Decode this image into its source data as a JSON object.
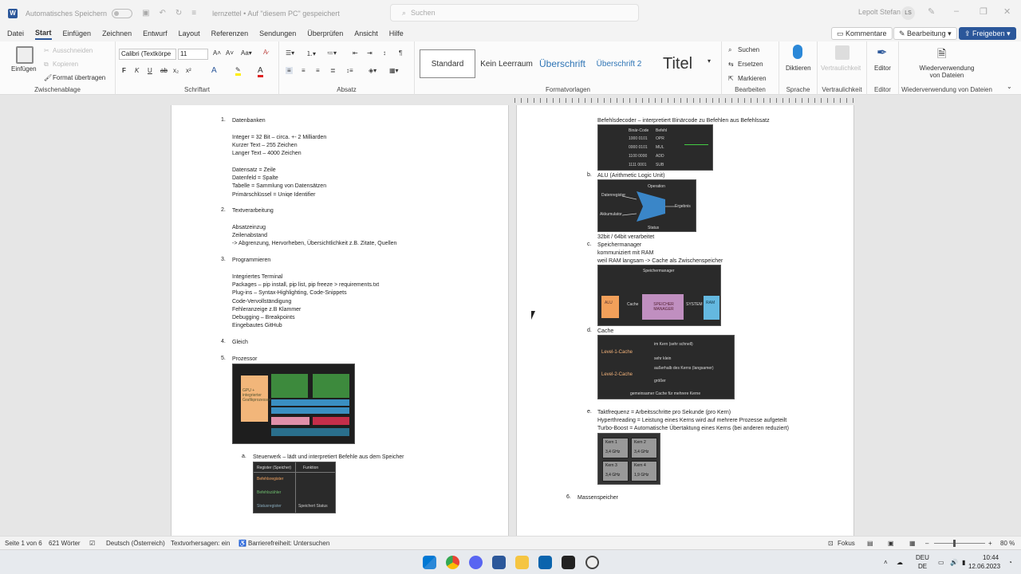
{
  "titlebar": {
    "autosave_label": "Automatisches Speichern",
    "doc_title": "lernzettel • Auf \"diesem PC\" gespeichert",
    "search_placeholder": "Suchen",
    "user_name": "Lepolt Stefan",
    "user_initials": "LS"
  },
  "menu": {
    "items": [
      "Datei",
      "Start",
      "Einfügen",
      "Zeichnen",
      "Entwurf",
      "Layout",
      "Referenzen",
      "Sendungen",
      "Überprüfen",
      "Ansicht",
      "Hilfe"
    ],
    "comments": "Kommentare",
    "editing": "Bearbeitung",
    "share": "Freigeben"
  },
  "ribbon": {
    "paste": "Einfügen",
    "cut": "Ausschneiden",
    "copy": "Kopieren",
    "format_painter": "Format übertragen",
    "clipboard": "Zwischenablage",
    "font_name": "Calibri (Textkörpe",
    "font_size": "11",
    "font_group": "Schriftart",
    "paragraph_group": "Absatz",
    "styles": [
      "Standard",
      "Kein Leerraum",
      "Überschrift",
      "Überschrift 2",
      "Titel"
    ],
    "styles_group": "Formatvorlagen",
    "find": "Suchen",
    "replace": "Ersetzen",
    "select": "Markieren",
    "edit_group": "Bearbeiten",
    "dictate": "Diktieren",
    "voice_group": "Sprache",
    "sensitivity": "Vertraulichkeit",
    "sensitivity_group": "Vertraulichkeit",
    "editor": "Editor",
    "editor_group": "Editor",
    "reuse": "Wiederverwendung von Dateien",
    "reuse_group": "Wiederverwendung von Dateien"
  },
  "left_page": {
    "items": [
      {
        "num": "1.",
        "title": "Datenbanken"
      },
      {
        "num": "2.",
        "title": "Textverarbeitung"
      },
      {
        "num": "3.",
        "title": "Programmieren"
      },
      {
        "num": "4.",
        "title": "Gleich"
      },
      {
        "num": "5.",
        "title": "Prozessor"
      }
    ],
    "db_lines": [
      "Integer = 32 Bit – circa. +- 2 Milliarden",
      "Kurzer Text – 255 Zeichen",
      "Langer Text – 4000 Zeichen"
    ],
    "db_lines2": [
      "Datensatz = Zeile",
      "Datenfeld = Spalte",
      "Tabelle = Sammlung von Datensätzen",
      "Primärschlüssel = Uniqe Identifier"
    ],
    "text_lines": [
      "Absatzeinzug",
      "Zeilenabstand",
      "-> Abgrenzung, Hervorheben, Übersichtlichkeit z.B. Zitate, Quellen"
    ],
    "prog_lines": [
      "Integriertes Terminal",
      "Packages – pip install, pip list, pip freeze > requirements.txt",
      "Plug-ins – Syntax-Highlighting, Code-Snippets",
      "Code-Vervollständigung",
      "Fehleranzeige z.B Klammer",
      "Debugging – Breakpoints",
      "Eingebautes GitHub"
    ],
    "steuerwerk": "Steuerwerk – lädt und interpretiert Befehle aus dem Speicher",
    "steuerwerk_num": "a."
  },
  "right_page": {
    "decoder": "Befehlsdecoder – interpretiert Binärcode zu Befehlen aus Befehlssatz",
    "alu_num": "b.",
    "alu": "ALU (Arithmetic Logic Unit)",
    "alu_bits": "32bit / 64bit verarbeitet",
    "mem_num": "c.",
    "mem_lines": [
      "Speichermanager",
      "kommuniziert mit RAM",
      "weil RAM langsam -> Cache als Zwischenspeicher"
    ],
    "cache_num": "d.",
    "cache": "Cache",
    "freq_num": "e.",
    "freq_lines": [
      "Taktfrequenz = Arbeitsschritte pro Sekunde (pro Kern)",
      "Hyperthreading = Leistung eines Kerns wird auf mehrere Prozesse aufgeteilt",
      "Turbo-Boost = Automatische Übertaktung eines Kerns (bei anderen reduziert)"
    ],
    "mass_num": "6.",
    "mass": "Massenspeicher"
  },
  "images": {
    "cpu_label": "GPU + integrierter Grafikprozessor",
    "alu_labels": [
      "Datenregister",
      "Akkumulator",
      "Operation",
      "Ergebnis",
      "Status"
    ],
    "mem_labels": [
      "Speichermanager",
      "ALU",
      "Cache",
      "SPEICHER MANAGER",
      "SYSTEM",
      "RAM"
    ],
    "cache_labels": [
      "Level-1-Cache",
      "Level-2-Cache",
      "im Kern (sehr schnell)",
      "sehr klein",
      "außerhalb des Kerns (langsamer)",
      "größer",
      "gemeinsamer Cache für mehrere Kerne"
    ],
    "cores": [
      "Kern 1",
      "Kern 2",
      "Kern 3",
      "Kern 4"
    ],
    "core_freqs": [
      "3,4 GHz",
      "3,4 GHz",
      "3,4 GHz",
      "1,9 GHz"
    ],
    "steuer_labels": [
      "Register (Speicher)",
      "Funktion",
      "Befehlsregister",
      "Befehlszähler",
      "Statusregister",
      "Speichert Status"
    ],
    "decoder_cols": [
      "Binär-Code",
      "Befehl"
    ],
    "decoder_rows": [
      [
        "1000 0101",
        "OPR"
      ],
      [
        "0000 0101",
        "MUL"
      ],
      [
        "1100 0000",
        "ADD"
      ],
      [
        "1111 0001",
        "SUB"
      ]
    ]
  },
  "statusbar": {
    "page": "Seite 1 von 6",
    "words": "621 Wörter",
    "language": "Deutsch (Österreich)",
    "predictions": "Textvorhersagen: ein",
    "accessibility": "Barrierefreiheit: Untersuchen",
    "focus": "Fokus",
    "zoom": "80 %"
  },
  "taskbar": {
    "lang1": "DEU",
    "lang2": "DE",
    "time": "10:44",
    "date": "12.06.2023"
  }
}
